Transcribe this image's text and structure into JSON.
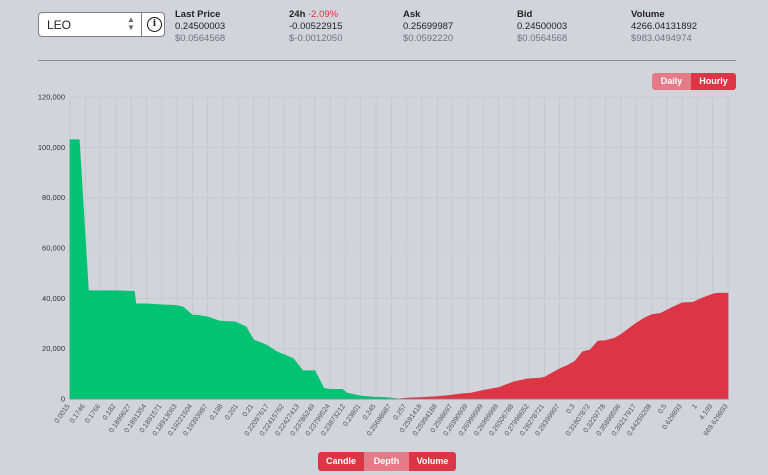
{
  "market": {
    "value": "LEO",
    "caret_icon": "up-down-chevron-icon",
    "info_icon": "info-icon"
  },
  "stats": [
    {
      "title": "Last Price",
      "change": "",
      "value": "0.24500003",
      "usd": "$0.0564568"
    },
    {
      "title": "24h",
      "change": "-2.09%",
      "value": "-0.00522915",
      "usd": "$-0.0012050"
    },
    {
      "title": "Ask",
      "change": "",
      "value": "0.25699987",
      "usd": "$0.0592220"
    },
    {
      "title": "Bid",
      "change": "",
      "value": "0.24500003",
      "usd": "$0.0564568"
    },
    {
      "title": "Volume",
      "change": "",
      "value": "4266.04131892",
      "usd": "$983.0494974"
    }
  ],
  "timeframe": {
    "daily": "Daily",
    "hourly": "Hourly",
    "active": "Hourly"
  },
  "view_tabs": {
    "candle": "Candle",
    "depth": "Depth",
    "volume": "Volume",
    "active": "Depth"
  },
  "colors": {
    "bid": "#02c373",
    "ask": "#dc3545",
    "background": "#d1d4da"
  },
  "chart_data": {
    "type": "area",
    "title": "",
    "xlabel": "",
    "ylabel": "",
    "ylim": [
      0,
      120000
    ],
    "yticks": [
      0,
      20000,
      40000,
      60000,
      80000,
      100000,
      120000
    ],
    "ytick_labels": [
      "0",
      "20,000",
      "40,000",
      "60,000",
      "80,000",
      "100,000",
      "120,000"
    ],
    "grid": true,
    "xtick_labels": [
      "0.0015",
      "0.1746",
      "0.1766",
      "0.182",
      "0.1899627",
      "0.1891354",
      "0.1891571",
      "0.18913063",
      "0.19221504",
      "0.19393987",
      "0.198",
      "0.201",
      "0.21",
      "0.22097617",
      "0.22415762",
      "0.22427413",
      "0.23785249",
      "0.23799524",
      "0.23873212",
      "0.23801",
      "0.245",
      "0.25698987",
      "0.257",
      "0.2591418",
      "0.25994188",
      "0.2598697",
      "0.26990999",
      "0.26999999",
      "0.26999999",
      "0.26506788",
      "0.27998652",
      "0.28278721",
      "0.29399997",
      "0.3",
      "0.31807872",
      "0.3229778",
      "0.35898596",
      "0.39217917",
      "0.44259208",
      "0.5",
      "0.629893",
      "1",
      "4.199",
      "669.629893"
    ],
    "series": [
      {
        "name": "",
        "side": "bid",
        "x_index": [
          0,
          0.6,
          1.2,
          1.7,
          2,
          3,
          3.8,
          4.2,
          4.3,
          5,
          6,
          6.9,
          7.4,
          8,
          8.4,
          9,
          9.8,
          10.8,
          11.5,
          12,
          12.5,
          12.9,
          13.5,
          14,
          14.6,
          15.2,
          16,
          16.6,
          17,
          17.8,
          18.1,
          19,
          19.8,
          20.6,
          21.3,
          21.4
        ],
        "values": [
          103000,
          103000,
          43000,
          43000,
          43000,
          43000,
          42800,
          42800,
          37800,
          37800,
          37400,
          37200,
          36500,
          33300,
          33200,
          32600,
          30900,
          30600,
          28700,
          23400,
          22300,
          21200,
          18800,
          17600,
          16000,
          11300,
          11200,
          4200,
          3800,
          3800,
          2300,
          1200,
          700,
          600,
          100,
          0
        ]
      },
      {
        "name": "",
        "side": "ask",
        "x_index": [
          21.5,
          22,
          23,
          24,
          24.7,
          25.5,
          26.2,
          27,
          28,
          29,
          29.9,
          30.2,
          30.7,
          31,
          32,
          32.4,
          33,
          33.5,
          34,
          34.5,
          35,
          35.6,
          36,
          36.5,
          37,
          37.5,
          38,
          38.6,
          39.3,
          40,
          40.7,
          41.3,
          42,
          42.3,
          43
        ],
        "values": [
          0,
          300,
          600,
          900,
          1300,
          2000,
          2300,
          3400,
          4500,
          6800,
          8000,
          8100,
          8300,
          8600,
          12000,
          13000,
          15000,
          18700,
          19500,
          23000,
          23200,
          24200,
          25600,
          27800,
          30100,
          32000,
          33500,
          34000,
          36200,
          38200,
          38400,
          40000,
          41700,
          42000,
          42000
        ]
      }
    ]
  }
}
